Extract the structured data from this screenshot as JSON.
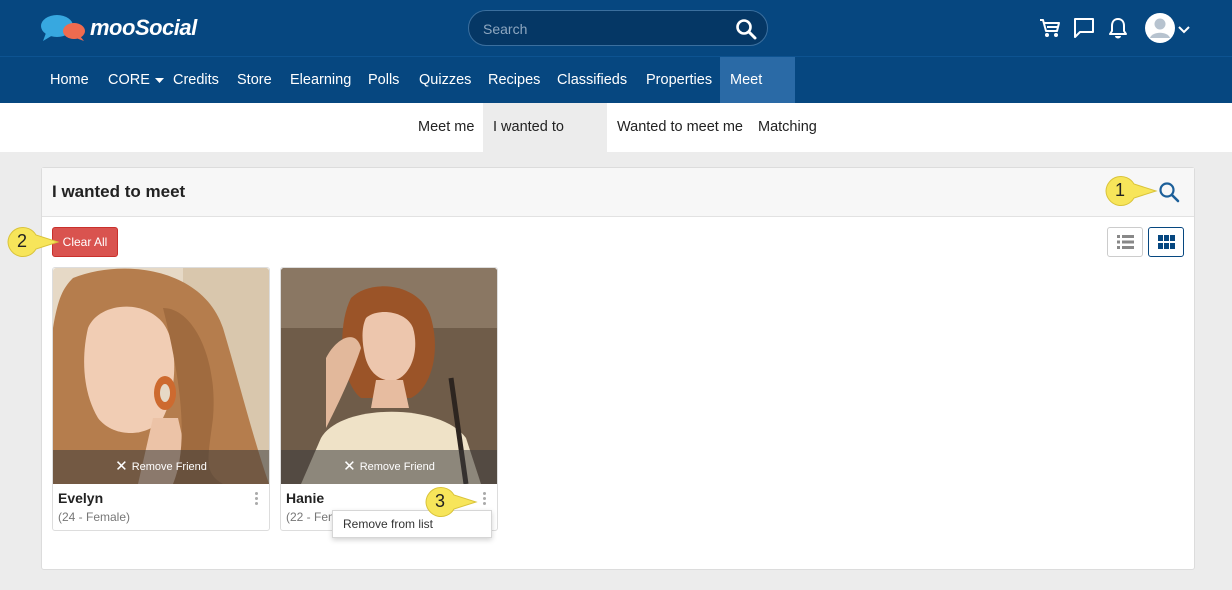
{
  "brand": {
    "name": "mooSocial",
    "colors": {
      "primary": "#064780",
      "active_nav": "#2a6aa6",
      "danger": "#d9534f",
      "callout": "#f7e55a"
    }
  },
  "search": {
    "placeholder": "Search",
    "value": ""
  },
  "top_icons": [
    "cart-icon",
    "chat-icon",
    "bell-icon",
    "avatar-icon",
    "chevron-down-icon"
  ],
  "nav": {
    "items": [
      {
        "label": "Home",
        "icon": ""
      },
      {
        "label": "CORE",
        "icon": "caret-down-icon"
      },
      {
        "label": "Credits"
      },
      {
        "label": "Store"
      },
      {
        "label": "Elearning"
      },
      {
        "label": "Polls"
      },
      {
        "label": "Quizzes"
      },
      {
        "label": "Recipes"
      },
      {
        "label": "Classifieds"
      },
      {
        "label": "Properties"
      },
      {
        "label": "Meet me"
      }
    ],
    "active": "Meet me"
  },
  "subnav": {
    "items": [
      {
        "label": "Meet me"
      },
      {
        "label": "I wanted to meet"
      },
      {
        "label": "Wanted to meet me"
      },
      {
        "label": "Matching"
      }
    ],
    "active": "I wanted to meet"
  },
  "panel": {
    "title": "I wanted to meet",
    "clear_all_label": "Clear All",
    "view_modes": [
      "list-view-icon",
      "grid-view-icon"
    ],
    "active_view": "grid"
  },
  "cards": [
    {
      "name": "Evelyn",
      "meta": "(24 - Female)",
      "remove_label": "Remove Friend"
    },
    {
      "name": "Hanie",
      "meta": "(22 - Female)",
      "remove_label": "Remove Friend"
    }
  ],
  "dropdown": {
    "items": [
      {
        "label": "Remove from list"
      }
    ]
  },
  "callouts": [
    "1",
    "2",
    "3"
  ]
}
